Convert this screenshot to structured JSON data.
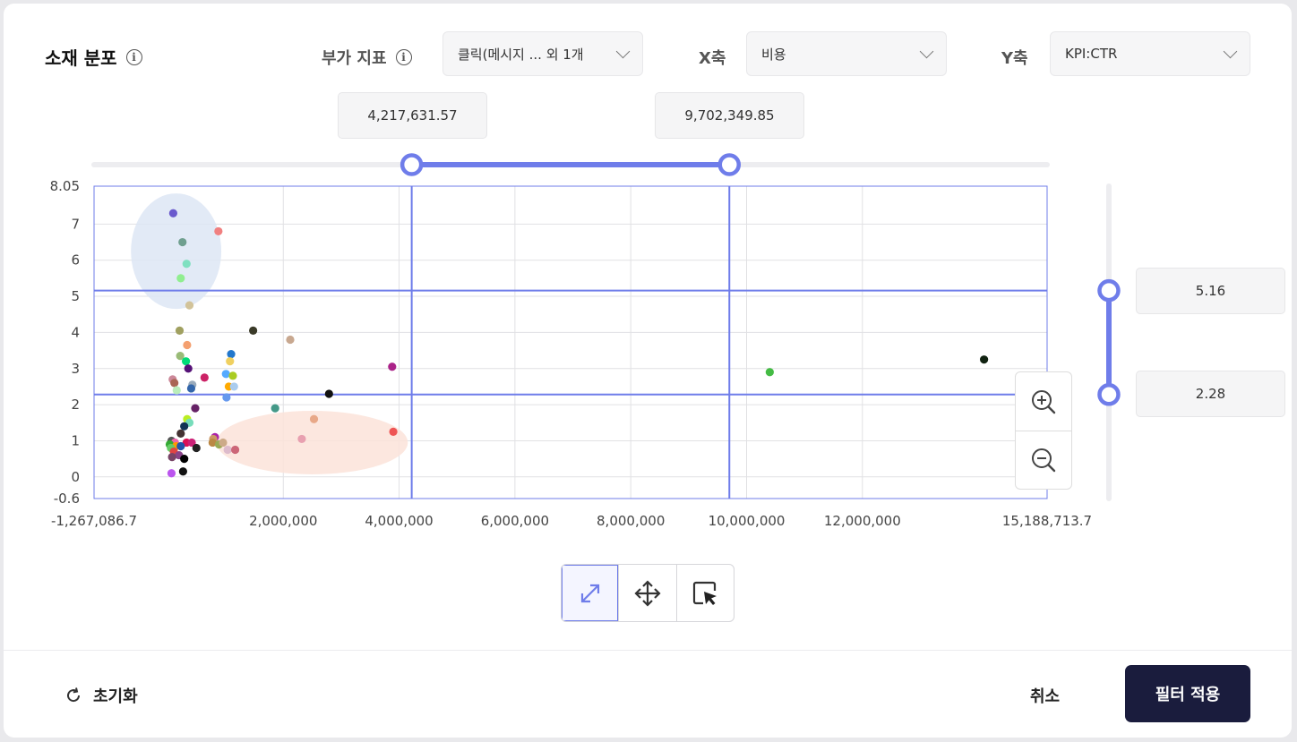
{
  "header": {
    "title": "소재 분포",
    "extra_metric_label": "부가 지표",
    "extra_metric_value": "클릭(메시지 ... 외 1개",
    "x_axis_label": "X축",
    "x_axis_value": "비용",
    "y_axis_label": "Y축",
    "y_axis_value": "KPI:CTR"
  },
  "x_range": {
    "low": "4,217,631.57",
    "high": "9,702,349.85",
    "low_value": 4217631.57,
    "high_value": 9702349.85
  },
  "y_range": {
    "high": "5.16",
    "low": "2.28",
    "high_value": 5.16,
    "low_value": 2.28
  },
  "footer": {
    "reset_label": "초기화",
    "cancel_label": "취소",
    "apply_label": "필터 적용"
  },
  "colors": {
    "accent": "#6f7dea",
    "apply_bg": "#1a1c3d",
    "grid": "#dddddd",
    "selection": "#7b86ee"
  },
  "icons": {
    "info": "info-icon",
    "chevron": "chevron-down-icon",
    "zoom_in": "zoom-in-icon",
    "zoom_out": "zoom-out-icon",
    "fit": "expand-icon",
    "pan": "move-icon",
    "select": "select-cursor-icon",
    "reset": "refresh-icon"
  },
  "chart_data": {
    "type": "scatter",
    "title": "",
    "xlabel": "",
    "ylabel": "",
    "xlim": [
      -1267086.7,
      15188713.7
    ],
    "ylim": [
      -0.6,
      8.05
    ],
    "x_ticks": [
      -1267086.7,
      2000000,
      4000000,
      6000000,
      8000000,
      10000000,
      12000000,
      15188713.7
    ],
    "x_tick_labels": [
      "-1,267,086.7",
      "2,000,000",
      "4,000,000",
      "6,000,000",
      "8,000,000",
      "10,000,000",
      "12,000,000",
      "15,188,713.7"
    ],
    "y_ticks": [
      -0.6,
      0,
      1,
      2,
      3,
      4,
      5,
      6,
      7,
      8.05
    ],
    "y_tick_labels": [
      "-0.6",
      "0",
      "1",
      "2",
      "3",
      "4",
      "5",
      "6",
      "7",
      "8.05"
    ],
    "grid": true,
    "legend": "none",
    "highlight_regions": [
      {
        "cx": 150000,
        "cy": 6.25,
        "rx": 780000,
        "ry": 1.6,
        "color": "#dde6f5"
      },
      {
        "cx": 2500000,
        "cy": 0.95,
        "rx": 1650000,
        "ry": 0.88,
        "color": "#fbe3d9"
      }
    ],
    "points": [
      {
        "x": 100000,
        "y": 7.3,
        "color": "#6a5acd"
      },
      {
        "x": 880000,
        "y": 6.8,
        "color": "#f08080"
      },
      {
        "x": 260000,
        "y": 6.5,
        "color": "#6f9f8f"
      },
      {
        "x": 330000,
        "y": 5.9,
        "color": "#7fe0c0"
      },
      {
        "x": 230000,
        "y": 5.5,
        "color": "#90ee90"
      },
      {
        "x": 380000,
        "y": 4.75,
        "color": "#d2c39a"
      },
      {
        "x": 210000,
        "y": 4.05,
        "color": "#a0a060"
      },
      {
        "x": 1480000,
        "y": 4.05,
        "color": "#3a3a28"
      },
      {
        "x": 2120000,
        "y": 3.8,
        "color": "#c8a890"
      },
      {
        "x": 340000,
        "y": 3.65,
        "color": "#f4a070"
      },
      {
        "x": 1100000,
        "y": 3.4,
        "color": "#2277cc"
      },
      {
        "x": 220000,
        "y": 3.35,
        "color": "#99bb77"
      },
      {
        "x": 320000,
        "y": 3.2,
        "color": "#00dd77"
      },
      {
        "x": 1080000,
        "y": 3.2,
        "color": "#f0d060"
      },
      {
        "x": 3880000,
        "y": 3.05,
        "color": "#aa2288"
      },
      {
        "x": 360000,
        "y": 3.0,
        "color": "#551177"
      },
      {
        "x": 1010000,
        "y": 2.85,
        "color": "#55aaff"
      },
      {
        "x": 1130000,
        "y": 2.8,
        "color": "#aacc22"
      },
      {
        "x": 640000,
        "y": 2.75,
        "color": "#cc2266"
      },
      {
        "x": 90000,
        "y": 2.7,
        "color": "#cc8899"
      },
      {
        "x": 120000,
        "y": 2.6,
        "color": "#aa6655"
      },
      {
        "x": 430000,
        "y": 2.55,
        "color": "#99aabb"
      },
      {
        "x": 410000,
        "y": 2.45,
        "color": "#3366aa"
      },
      {
        "x": 1060000,
        "y": 2.5,
        "color": "#ffaa00"
      },
      {
        "x": 1150000,
        "y": 2.5,
        "color": "#aaccee"
      },
      {
        "x": 160000,
        "y": 2.4,
        "color": "#bbeebb"
      },
      {
        "x": 2790000,
        "y": 2.3,
        "color": "#111111"
      },
      {
        "x": 1020000,
        "y": 2.2,
        "color": "#6699ee"
      },
      {
        "x": 10400000,
        "y": 2.9,
        "color": "#44bb44"
      },
      {
        "x": 14100000,
        "y": 3.25,
        "color": "#112211"
      },
      {
        "x": 1860000,
        "y": 1.9,
        "color": "#449988"
      },
      {
        "x": 480000,
        "y": 1.9,
        "color": "#662266"
      },
      {
        "x": 340000,
        "y": 1.6,
        "color": "#bbee22"
      },
      {
        "x": 380000,
        "y": 1.5,
        "color": "#77ddbb"
      },
      {
        "x": 290000,
        "y": 1.4,
        "color": "#113355"
      },
      {
        "x": 2530000,
        "y": 1.6,
        "color": "#e8a888"
      },
      {
        "x": 230000,
        "y": 1.2,
        "color": "#443333"
      },
      {
        "x": 3900000,
        "y": 1.25,
        "color": "#ee5555"
      },
      {
        "x": 2320000,
        "y": 1.05,
        "color": "#e8a0b0"
      },
      {
        "x": 820000,
        "y": 1.1,
        "color": "#aa22aa"
      },
      {
        "x": 790000,
        "y": 1.05,
        "color": "#cc9966"
      },
      {
        "x": 70000,
        "y": 1.0,
        "color": "#555555"
      },
      {
        "x": 130000,
        "y": 0.95,
        "color": "#ee66aa"
      },
      {
        "x": 330000,
        "y": 0.95,
        "color": "#dd1155"
      },
      {
        "x": 420000,
        "y": 0.95,
        "color": "#cc2277"
      },
      {
        "x": 780000,
        "y": 0.95,
        "color": "#bb8844"
      },
      {
        "x": 890000,
        "y": 0.9,
        "color": "#99aa55"
      },
      {
        "x": 960000,
        "y": 0.95,
        "color": "#ccaa88"
      },
      {
        "x": 40000,
        "y": 0.9,
        "color": "#33aa33"
      },
      {
        "x": 150000,
        "y": 0.85,
        "color": "#ff9900"
      },
      {
        "x": 230000,
        "y": 0.85,
        "color": "#2255aa"
      },
      {
        "x": 500000,
        "y": 0.8,
        "color": "#222222"
      },
      {
        "x": 60000,
        "y": 0.8,
        "color": "#66cc66"
      },
      {
        "x": 110000,
        "y": 0.7,
        "color": "#dd4444"
      },
      {
        "x": 1040000,
        "y": 0.75,
        "color": "#ddbbcc"
      },
      {
        "x": 1170000,
        "y": 0.75,
        "color": "#cc6677"
      },
      {
        "x": 200000,
        "y": 0.6,
        "color": "#884488"
      },
      {
        "x": 80000,
        "y": 0.55,
        "color": "#774466"
      },
      {
        "x": 290000,
        "y": 0.5,
        "color": "#000000"
      },
      {
        "x": 70000,
        "y": 0.1,
        "color": "#bb55ee"
      },
      {
        "x": 270000,
        "y": 0.15,
        "color": "#111111"
      }
    ]
  }
}
